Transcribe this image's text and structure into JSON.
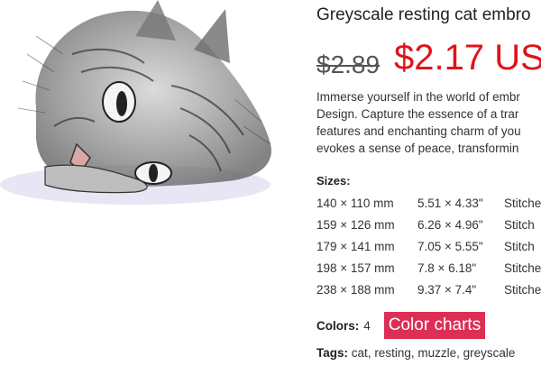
{
  "product": {
    "title": "Greyscale resting cat embro",
    "old_price": "$2.89",
    "new_price": "$2.17 US",
    "description_lines": [
      "Immerse yourself in the world of embr",
      "Design. Capture the essence of a trar",
      "features and enchanting charm of you",
      "evokes a sense of peace, transformin"
    ]
  },
  "sizes": {
    "label": "Sizes:",
    "rows": [
      {
        "mm": "140 × 110 mm",
        "inch": "5.51 × 4.33\"",
        "stitches": "Stitche"
      },
      {
        "mm": "159 × 126 mm",
        "inch": "6.26 × 4.96\"",
        "stitches": "Stitch"
      },
      {
        "mm": "179 × 141 mm",
        "inch": "7.05 × 5.55\"",
        "stitches": "Stitch"
      },
      {
        "mm": "198 × 157 mm",
        "inch": "7.8 × 6.18\"",
        "stitches": "Stitches"
      },
      {
        "mm": "238 × 188 mm",
        "inch": "9.37 × 7.4\"",
        "stitches": "Stitches"
      }
    ]
  },
  "colors": {
    "label": "Colors:",
    "count": "4",
    "button_label": "Color charts",
    "button_color": "#dd2f55"
  },
  "tags": {
    "label": "Tags:",
    "items": [
      "cat",
      "resting",
      "muzzle",
      "greyscale"
    ]
  },
  "theme": {
    "price_color": "#e0141a"
  }
}
